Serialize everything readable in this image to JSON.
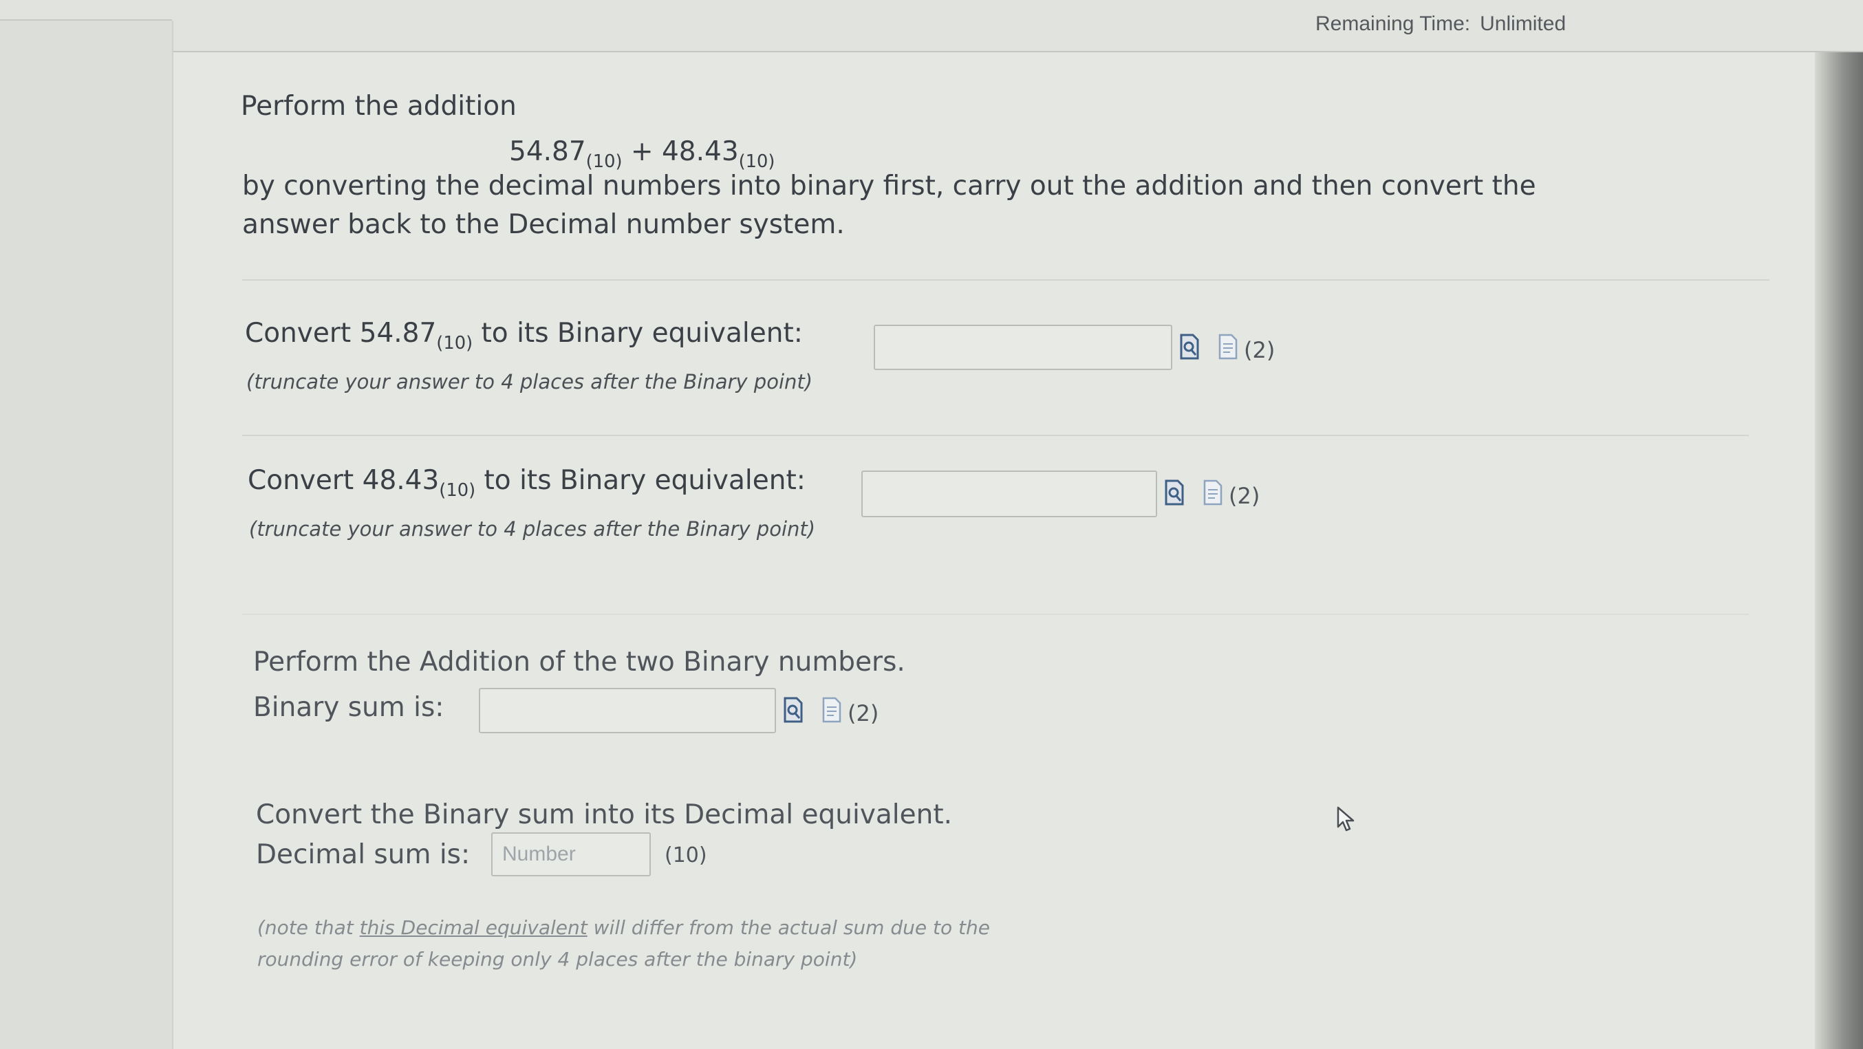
{
  "header": {
    "remaining_label": "Remaining Time:",
    "remaining_value": "Unlimited"
  },
  "question": {
    "intro": "Perform the addition",
    "expression": {
      "a": "54.87",
      "a_base": "(10)",
      "op": "+",
      "b": "48.43",
      "b_base": "(10)"
    },
    "instruction_line1": "by converting the decimal numbers into binary first, carry out the addition and then convert the",
    "instruction_line2": "answer back to the Decimal number system."
  },
  "part1": {
    "prefix": "Convert",
    "number": "54.87",
    "base": "(10)",
    "suffix": "to its Binary equivalent:",
    "hint": "(truncate your answer to 4 places after the Binary point)",
    "value": "",
    "marks": "(2)"
  },
  "part2": {
    "prefix": "Convert",
    "number": "48.43",
    "base": "(10)",
    "suffix": "to its Binary equivalent:",
    "hint": "(truncate your answer to 4 places after the Binary point)",
    "value": "",
    "marks": "(2)"
  },
  "part3": {
    "heading": "Perform the Addition of the two Binary numbers.",
    "label": "Binary sum is:",
    "value": "",
    "marks": "(2)"
  },
  "part4": {
    "heading": "Convert the Binary sum into its Decimal equivalent.",
    "label": "Decimal sum is:",
    "placeholder": "Number",
    "value": "",
    "marks": "(10)",
    "note_prefix": "(note that ",
    "note_link": "this Decimal equivalent",
    "note_rest": " will differ from the actual sum due to the",
    "note_line2": "rounding error of keeping only 4 places after the binary point)"
  },
  "icons": {
    "preview": "preview-document-icon",
    "template": "blank-document-icon",
    "cursor": "mouse-pointer-icon"
  },
  "colors": {
    "icon_blue": "#3f5f86",
    "icon_light": "#8ea3bd",
    "text": "#3e444a",
    "border": "#b9bdb8"
  }
}
